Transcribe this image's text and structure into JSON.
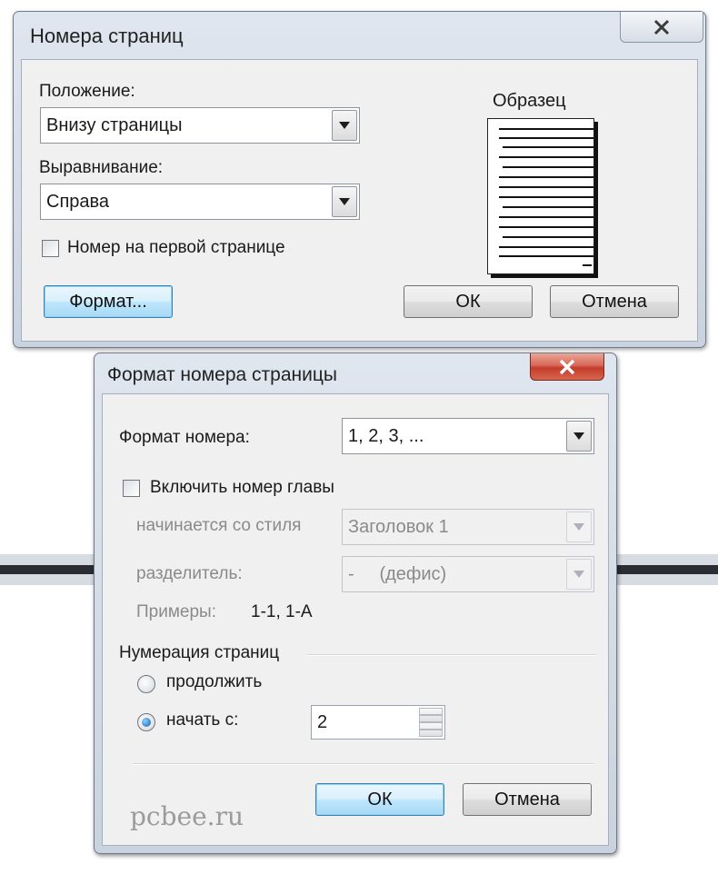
{
  "page_numbers_dialog": {
    "title": "Номера страниц",
    "position_label": "Положение:",
    "position_value": "Внизу страницы",
    "alignment_label": "Выравнивание:",
    "alignment_value": "Справа",
    "first_page_checkbox_label": "Номер на первой странице",
    "first_page_checked": false,
    "format_button": "Формат...",
    "ok_button": "ОК",
    "cancel_button": "Отмена",
    "preview_label": "Образец"
  },
  "page_number_format_dialog": {
    "title": "Формат номера страницы",
    "number_format_label": "Формат номера:",
    "number_format_value": "1, 2, 3, ...",
    "include_chapter_label": "Включить номер главы",
    "include_chapter_checked": false,
    "chapter_style_label": "начинается со стиля",
    "chapter_style_value": "Заголовок 1",
    "separator_label": "разделитель:",
    "separator_value": "-     (дефис)",
    "examples_label": "Примеры:",
    "examples_value": "1-1, 1-А",
    "numbering_section_label": "Нумерация страниц",
    "continue_label": "продолжить",
    "start_at_label": "начать с:",
    "selected_numbering": "start_at",
    "start_at_value": "2",
    "ok_button": "ОК",
    "cancel_button": "Отмена"
  },
  "watermark": "pcbee.ru",
  "colors": {
    "frame": "#c9d3df",
    "client": "#f0f0f0",
    "close_red": "#c43c2c",
    "focus_blue": "#3c7fb1"
  },
  "icons": [
    "close-icon",
    "dropdown-arrow-icon",
    "spin-up-icon",
    "spin-down-icon"
  ]
}
